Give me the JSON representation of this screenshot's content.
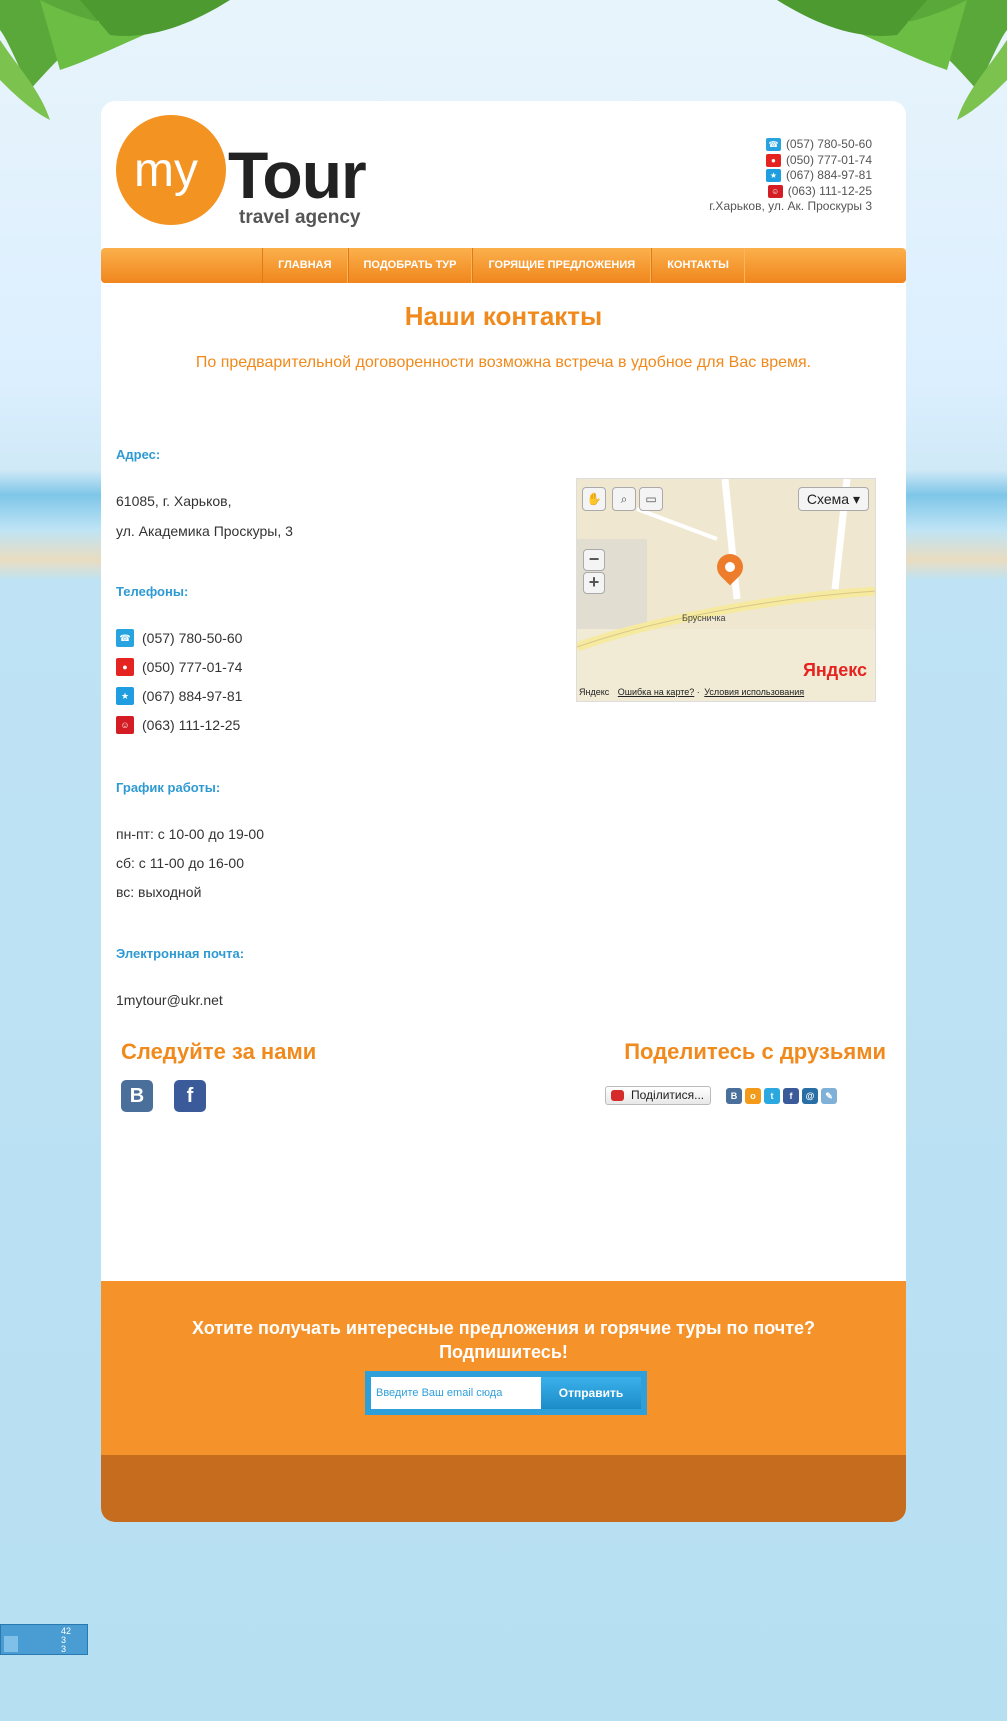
{
  "header": {
    "logo_my": "my",
    "logo_tour": "Tour",
    "logo_sub": "travel agency",
    "phones": [
      {
        "op": "tel",
        "number": "(057) 780-50-60"
      },
      {
        "op": "mts",
        "number": "(050) 777-01-74"
      },
      {
        "op": "kyivstar",
        "number": "(067) 884-97-81"
      },
      {
        "op": "life",
        "number": "(063) 111-12-25"
      }
    ],
    "address": "г.Харьков, ул. Ак. Проскуры 3"
  },
  "nav": {
    "items": [
      "ГЛАВНАЯ",
      "ПОДОБРАТЬ ТУР",
      "ГОРЯЩИЕ ПРЕДЛОЖЕНИЯ",
      "КОНТАКТЫ"
    ]
  },
  "main": {
    "title": "Наши контакты",
    "subtitle": "По предварительной договоренности возможна встреча в удобное для Вас время.",
    "address_label": "Адрес:",
    "address_line1": "61085, г. Харьков,",
    "address_line2": "ул. Академика Проскуры, 3",
    "phones_label": "Телефоны:",
    "phones": [
      "(057) 780-50-60",
      "(050) 777-01-74",
      "(067) 884-97-81",
      "(063) 111-12-25"
    ],
    "schedule_label": "График работы:",
    "schedule": [
      "пн-пт: с 10-00 до 19-00",
      "сб: с 11-00 до 16-00",
      "вс: выходной"
    ],
    "email_label": "Электронная почта:",
    "email": "1mytour@ukr.net"
  },
  "map": {
    "scheme_label": "Схема ▾",
    "poi": "Брусничка",
    "brand": "Яндекс",
    "footer_brand": "Яндекс",
    "footer_error": "Ошибка на карте?",
    "footer_terms": "Условия использования"
  },
  "social": {
    "follow_title": "Следуйте за нами",
    "share_title": "Поделитесь с друзьями",
    "share_button": "Поділитися...",
    "vk_label": "B",
    "fb_label": "f"
  },
  "subscribe": {
    "line1": "Хотите получать интересные предложения и горячие туры по почте?",
    "line2": "Подпишитесь!",
    "placeholder": "Введите Ваш email сюда",
    "button": "Отправить"
  },
  "counter": {
    "line1": "42",
    "line2": "3",
    "line3": "3"
  },
  "colors": {
    "accent": "#f08a1c",
    "label_blue": "#2e9ad3",
    "subscribe_bg": "#f6922a",
    "footer_bar": "#c66c1e"
  }
}
